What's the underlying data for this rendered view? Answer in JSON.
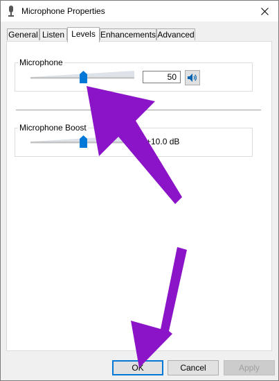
{
  "window": {
    "title": "Microphone Properties"
  },
  "tabs": [
    {
      "label": "General"
    },
    {
      "label": "Listen"
    },
    {
      "label": "Levels",
      "active": true
    },
    {
      "label": "Enhancements"
    },
    {
      "label": "Advanced"
    }
  ],
  "levels": {
    "microphone": {
      "label": "Microphone",
      "value": "50",
      "level": 0.5
    },
    "boost": {
      "label": "Microphone Boost",
      "value": "+10.0 dB",
      "level": 0.5
    }
  },
  "buttons": {
    "ok": "OK",
    "cancel": "Cancel",
    "apply": "Apply"
  },
  "colors": {
    "annotation_arrow": "#8b14c8",
    "accent": "#0078d7"
  }
}
